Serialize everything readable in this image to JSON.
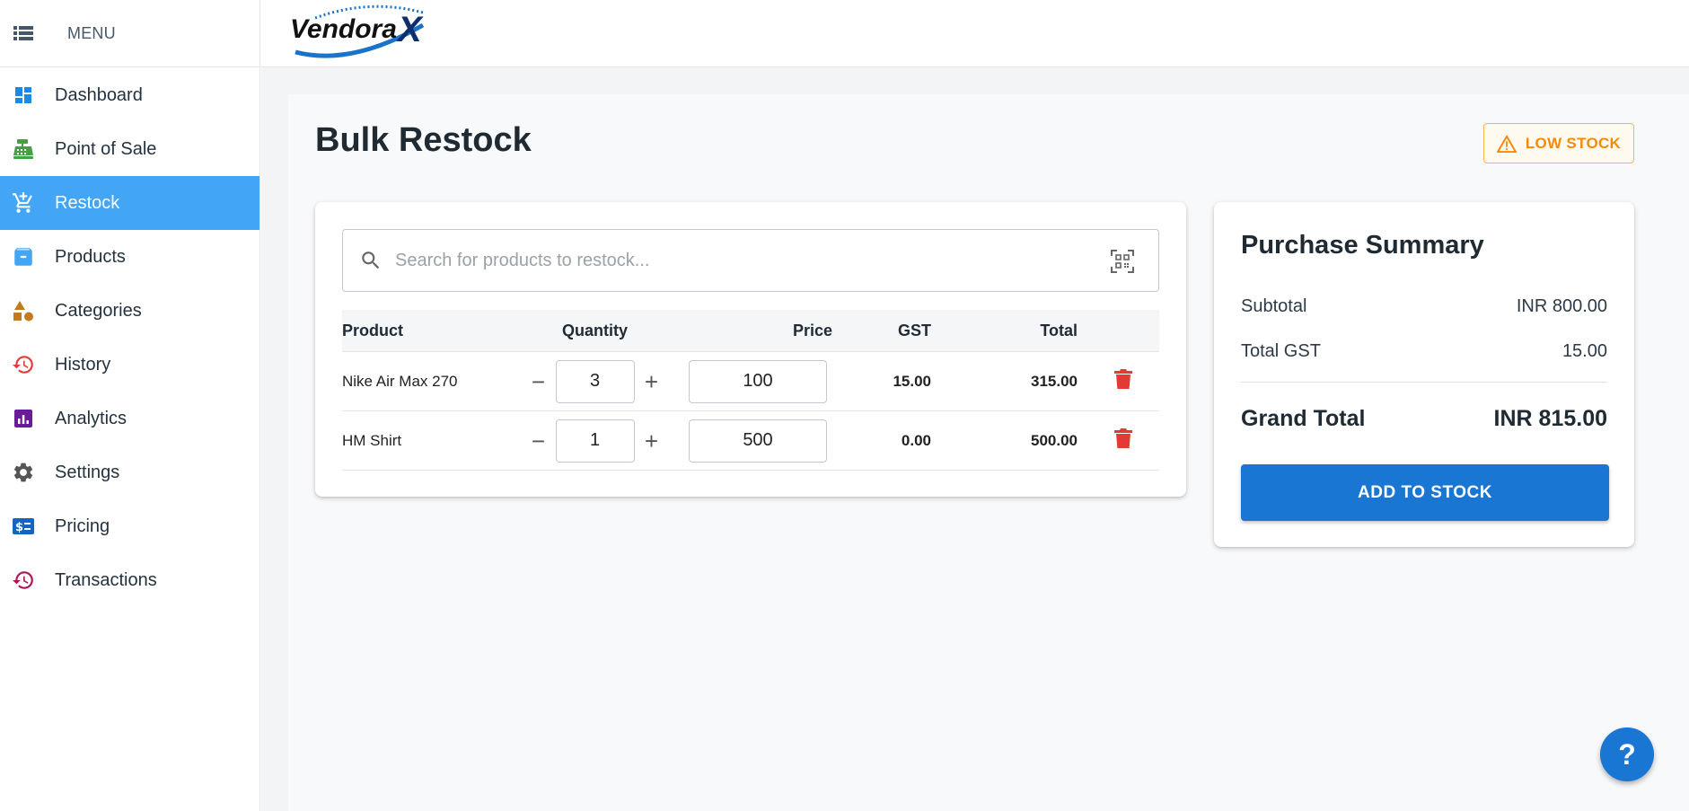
{
  "sidebar": {
    "menu_label": "MENU",
    "items": [
      {
        "label": "Dashboard",
        "icon": "dashboard-icon",
        "color": "#1e88e5"
      },
      {
        "label": "Point of Sale",
        "icon": "cash-register-icon",
        "color": "#43a047"
      },
      {
        "label": "Restock",
        "icon": "cart-plus-icon",
        "color": "#ffffff",
        "active": true
      },
      {
        "label": "Products",
        "icon": "archive-box-icon",
        "color": "#42a5f5"
      },
      {
        "label": "Categories",
        "icon": "category-shapes-icon",
        "color": "#c47a1c"
      },
      {
        "label": "History",
        "icon": "history-icon",
        "color": "#e53935"
      },
      {
        "label": "Analytics",
        "icon": "analytics-icon",
        "color": "#6a1b9a"
      },
      {
        "label": "Settings",
        "icon": "gear-icon",
        "color": "#555555"
      },
      {
        "label": "Pricing",
        "icon": "pricing-icon",
        "color": "#1565c0"
      },
      {
        "label": "Transactions",
        "icon": "history-icon",
        "color": "#ad1457"
      }
    ]
  },
  "header": {
    "logo_text": "Vendora",
    "logo_mark": "X"
  },
  "page": {
    "title": "Bulk Restock",
    "low_stock_label": "LOW STOCK"
  },
  "search": {
    "placeholder": "Search for products to restock..."
  },
  "table": {
    "headers": {
      "product": "Product",
      "quantity": "Quantity",
      "price": "Price",
      "gst": "GST",
      "total": "Total"
    },
    "rows": [
      {
        "product": "Nike Air Max 270",
        "quantity": "3",
        "price": "100",
        "gst": "15.00",
        "total": "315.00"
      },
      {
        "product": "HM Shirt",
        "quantity": "1",
        "price": "500",
        "gst": "0.00",
        "total": "500.00"
      }
    ]
  },
  "summary": {
    "title": "Purchase Summary",
    "subtotal_label": "Subtotal",
    "subtotal_value": "INR 800.00",
    "gst_label": "Total GST",
    "gst_value": "15.00",
    "grand_label": "Grand Total",
    "grand_value": "INR 815.00",
    "button_label": "ADD TO STOCK"
  },
  "help_label": "?",
  "colors": {
    "accent": "#1976d2",
    "active_nav": "#42a5f5",
    "warning": "#f58a07",
    "danger": "#e53935"
  }
}
